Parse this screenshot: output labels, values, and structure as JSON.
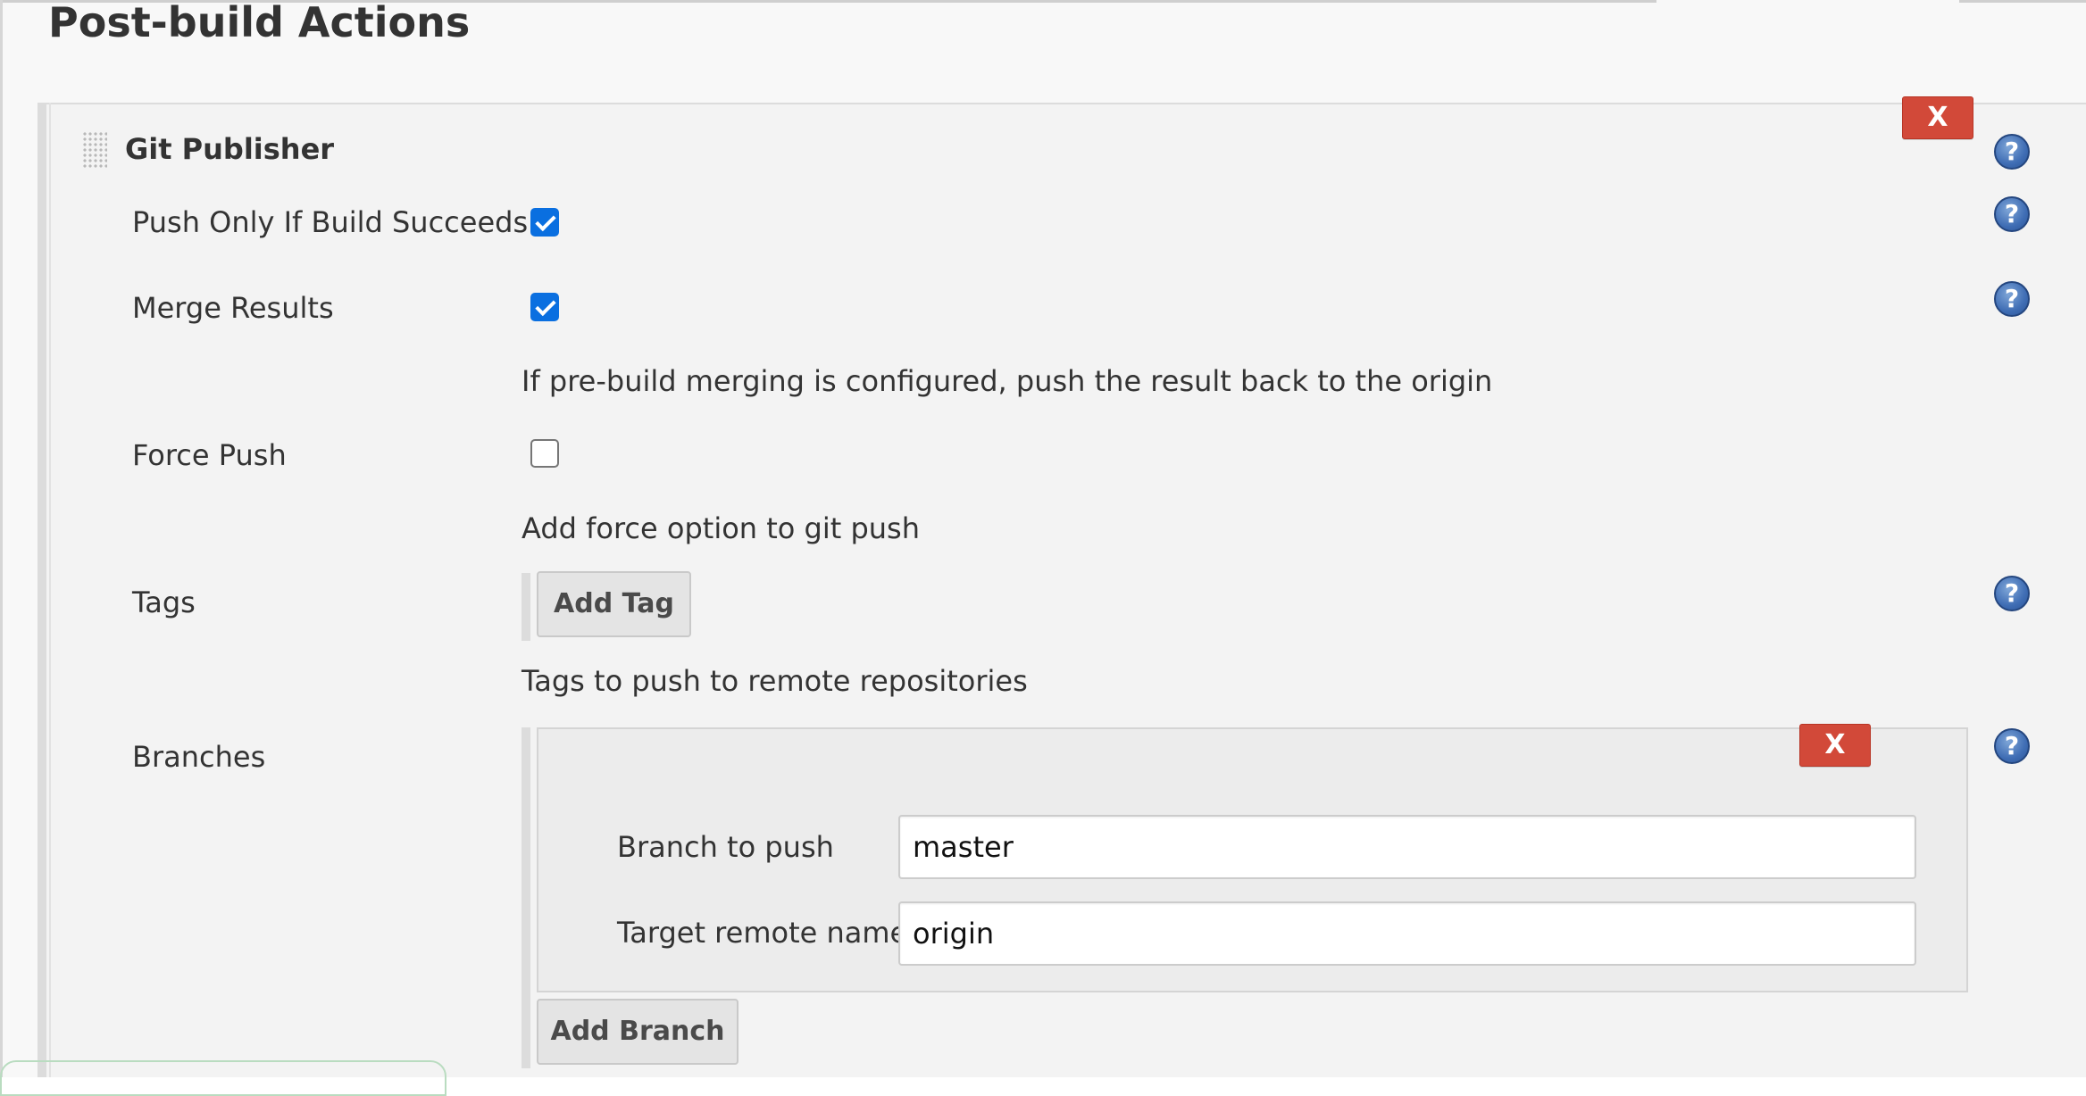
{
  "section": {
    "title": "Post-build Actions"
  },
  "publisher": {
    "title": "Git Publisher",
    "delete_label": "X",
    "help_glyph": "?"
  },
  "rows": {
    "push_only": {
      "label": "Push Only If Build Succeeds",
      "checked": true
    },
    "merge_results": {
      "label": "Merge Results",
      "checked": true,
      "description": "If pre-build merging is configured, push the result back to the origin"
    },
    "force_push": {
      "label": "Force Push",
      "checked": false,
      "description": "Add force option to git push"
    },
    "tags": {
      "label": "Tags",
      "add_button": "Add Tag",
      "description": "Tags to push to remote repositories"
    },
    "branches": {
      "label": "Branches",
      "delete_label": "X",
      "branch_to_push_label": "Branch to push",
      "branch_to_push_value": "master",
      "target_remote_label": "Target remote name",
      "target_remote_value": "origin",
      "add_button": "Add Branch"
    }
  },
  "colors": {
    "delete_button": "#d24939",
    "checkbox_checked": "#0a6fe0",
    "help_icon": "#3f6db4"
  }
}
